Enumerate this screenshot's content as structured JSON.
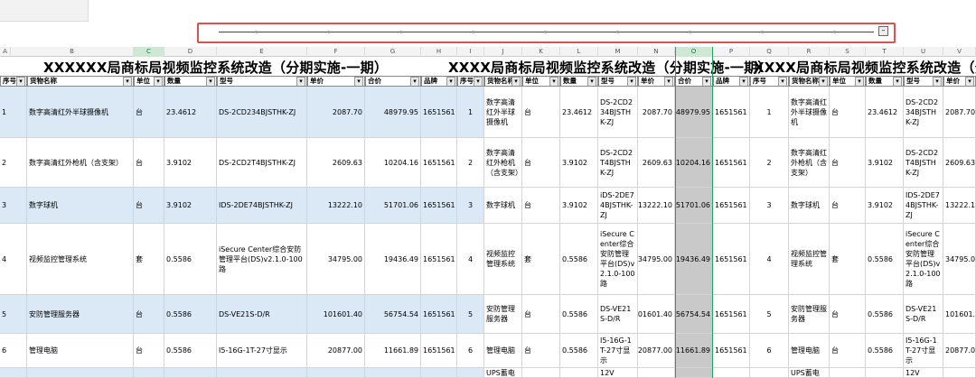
{
  "slicer": {
    "thumb": "–"
  },
  "columns": [
    "A",
    "B",
    "C",
    "D",
    "E",
    "F",
    "G",
    "H",
    "I",
    "J",
    "K",
    "L",
    "M",
    "N",
    "O",
    "P",
    "Q",
    "R",
    "S",
    "T",
    "U",
    "V"
  ],
  "titles": [
    "XXXXXX局商标局视频监控系统改造（分期实施-一期）",
    "XXXX局商标局视频监控系统改造（分期实施-一期）",
    "XXXX局商标局视频监控系统改造（分"
  ],
  "headers": {
    "seq": "序号",
    "name": "货物名称",
    "unit": "单位",
    "qty": "数量",
    "model": "型号",
    "price": "单价",
    "total": "合价",
    "brand": "品牌",
    "seq2": "序号2"
  },
  "rows": [
    {
      "no": "1",
      "name": "数字高清红外半球摄像机",
      "unit": "台",
      "qty": "23.4612",
      "model": "DS-2CD234BJSTHK-ZJ",
      "price": "2087.70",
      "total": "48979.95",
      "brand": "1651561"
    },
    {
      "no": "2",
      "name": "数字高清红外枪机（含支架）",
      "unit": "台",
      "qty": "3.9102",
      "model": "DS-2CD2T4BJSTHK-ZJ",
      "price": "2609.63",
      "total": "10204.16",
      "brand": "1651561"
    },
    {
      "no": "3",
      "name": "数字球机",
      "unit": "台",
      "qty": "3.9102",
      "model": "IDS-2DE74BJSTHK-ZJ",
      "price": "13222.10",
      "total": "51701.06",
      "brand": "1651561"
    },
    {
      "no": "4",
      "name": "视频监控管理系统",
      "unit": "套",
      "qty": "0.5586",
      "model": "iSecure Center综合安防管理平台(DS)v2.1.0-100路",
      "price": "34795.00",
      "total": "19436.49",
      "brand": "1651561"
    },
    {
      "no": "5",
      "name": "安防管理服务器",
      "unit": "台",
      "qty": "0.5586",
      "model": "DS-VE21S-D/R",
      "price": "101601.40",
      "total": "56754.54",
      "brand": "1651561"
    },
    {
      "no": "6",
      "name": "管理电脑",
      "unit": "台",
      "qty": "0.5586",
      "model": "I5-16G-1T-27寸显示",
      "price": "20877.00",
      "total": "11661.89",
      "brand": "1651561"
    },
    {
      "no": "",
      "name": "",
      "unit": "",
      "qty": "",
      "model": "",
      "price": "",
      "total": "",
      "brand": ""
    }
  ],
  "mid_rows": [
    {
      "name": "数字高清红外半球摄像机",
      "model": "DS-2CD234BJSTHK-ZJ"
    },
    {
      "name": "数字高清红外枪机（含支架）",
      "model": "DS-2CD2T4BJSTHK-ZJ"
    },
    {
      "name": "数字球机",
      "model": "iDS-2DE74BJSTHK-ZJ"
    },
    {
      "name": "视频监控管理系统",
      "model": "iSecure Center综合安防管理平台(DS)v2.1.0-100路"
    },
    {
      "name": "安防管理服务器",
      "model": "DS-VE21S-D/R"
    },
    {
      "name": "管理电脑",
      "model": "I5-16G-1T-27寸显示"
    },
    {
      "name": "UPS蓄电",
      "model": "12V"
    }
  ],
  "right_rows": [
    {
      "name": "数字高清红外半球摄像机",
      "model": "DS-2CD234BJSTHK-ZJ"
    },
    {
      "name": "数字高清红外枪机（含支架）",
      "model": "DS-2CD2T4BJSTHK-ZJ"
    },
    {
      "name": "数字球机",
      "model": "IDS-2DE74BJSTHK-ZJ"
    },
    {
      "name": "视频监控管理系统",
      "model": "iSecure Center综合安防管理平台(DS)v2.1.0-100路"
    },
    {
      "name": "安防管理服务器",
      "model": "DS-VE21S-D/R"
    },
    {
      "name": "管理电脑",
      "model": "I5-16G-1T-27寸显示"
    },
    {
      "name": "UPS蓄电",
      "model": "12V"
    }
  ]
}
